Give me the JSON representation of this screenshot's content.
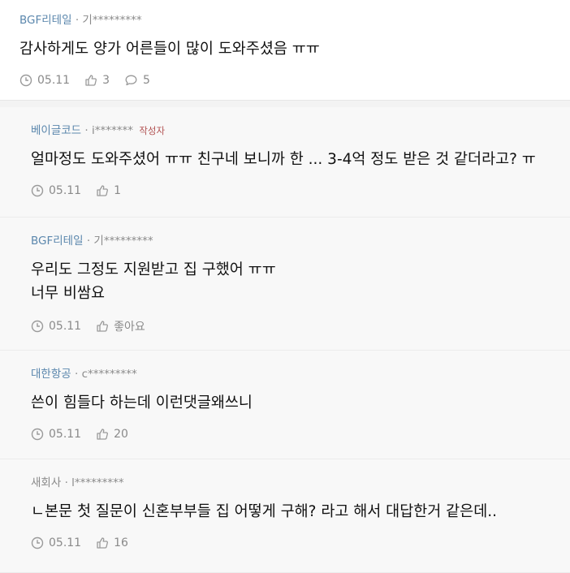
{
  "comments": [
    {
      "nick": "BGF리테일",
      "user": "기*********",
      "author_badge": "",
      "body": [
        "감사하게도 양가 어른들이 많이 도와주셨음 ㅠㅠ"
      ],
      "date": "05.11",
      "likes": "3",
      "replies": "5"
    },
    {
      "nick": "베이글코드",
      "user": "i*******",
      "author_badge": "작성자",
      "body": [
        "얼마정도 도와주셨어 ㅠㅠ 친구네 보니까 한 ... 3-4억 정도 받은 것 같더라고? ㅠ"
      ],
      "date": "05.11",
      "likes": "1"
    },
    {
      "nick": "BGF리테일",
      "user": "기*********",
      "author_badge": "",
      "body": [
        "우리도 그정도 지원받고 집 구했어 ㅠㅠ",
        "너무 비쌈요"
      ],
      "date": "05.11",
      "likes": "좋아요"
    },
    {
      "nick": "대한항공",
      "user": "c*********",
      "author_badge": "",
      "body": [
        "쓴이 힘들다 하는데 이런댓글왜쓰니"
      ],
      "date": "05.11",
      "likes": "20"
    },
    {
      "nick": "새회사",
      "user": "l*********",
      "author_badge": "",
      "body": [
        "ㄴ본문 첫 질문이 신혼부부들 집 어떻게 구해? 라고 해서 대답한거 같은데.."
      ],
      "date": "05.11",
      "likes": "16"
    }
  ],
  "separator": "·",
  "icons": {
    "time": "clock-icon",
    "like": "thumbs-up-icon",
    "reply": "speech-bubble-icon"
  }
}
